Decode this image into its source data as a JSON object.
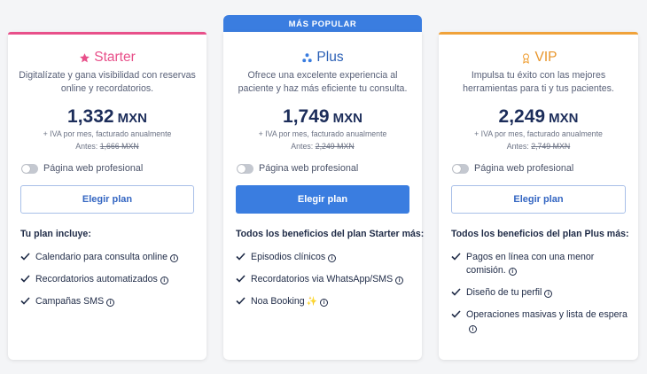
{
  "badge": "MÁS POPULAR",
  "plans": [
    {
      "name": "Starter",
      "icon": "star-icon",
      "accent": "#e8508a",
      "description": "Digitalízate y gana visibilidad con reservas online y recordatorios.",
      "price": "1,332",
      "currency": "MXN",
      "billing": "+ IVA por mes, facturado anualmente",
      "before_label": "Antes:",
      "before_price": "1,666 MXN",
      "toggle_label": "Página web profesional",
      "cta": "Elegir plan",
      "features_title": "Tu plan incluye:",
      "features": [
        "Calendario para consulta online",
        "Recordatorios automatizados",
        "Campañas SMS"
      ]
    },
    {
      "name": "Plus",
      "icon": "molecule-icon",
      "accent": "#3a7de0",
      "description": "Ofrece una excelente experiencia al paciente y haz más eficiente tu consulta.",
      "price": "1,749",
      "currency": "MXN",
      "billing": "+ IVA por mes, facturado anualmente",
      "before_label": "Antes:",
      "before_price": "2,249 MXN",
      "toggle_label": "Página web profesional",
      "cta": "Elegir plan",
      "features_title": "Todos los beneficios del plan Starter más:",
      "features": [
        "Episodios clínicos",
        "Recordatorios via WhatsApp/SMS",
        "Noa Booking"
      ]
    },
    {
      "name": "VIP",
      "icon": "award-icon",
      "accent": "#f0a23a",
      "description": "Impulsa tu éxito con las mejores herramientas para ti y tus pacientes.",
      "price": "2,249",
      "currency": "MXN",
      "billing": "+ IVA por mes, facturado anualmente",
      "before_label": "Antes:",
      "before_price": "2,749 MXN",
      "toggle_label": "Página web profesional",
      "cta": "Elegir plan",
      "features_title": "Todos los beneficios del plan Plus más:",
      "features": [
        "Pagos en línea con una menor comisión.",
        "Diseño de tu perfil",
        "Operaciones masivas y lista de espera"
      ]
    }
  ]
}
